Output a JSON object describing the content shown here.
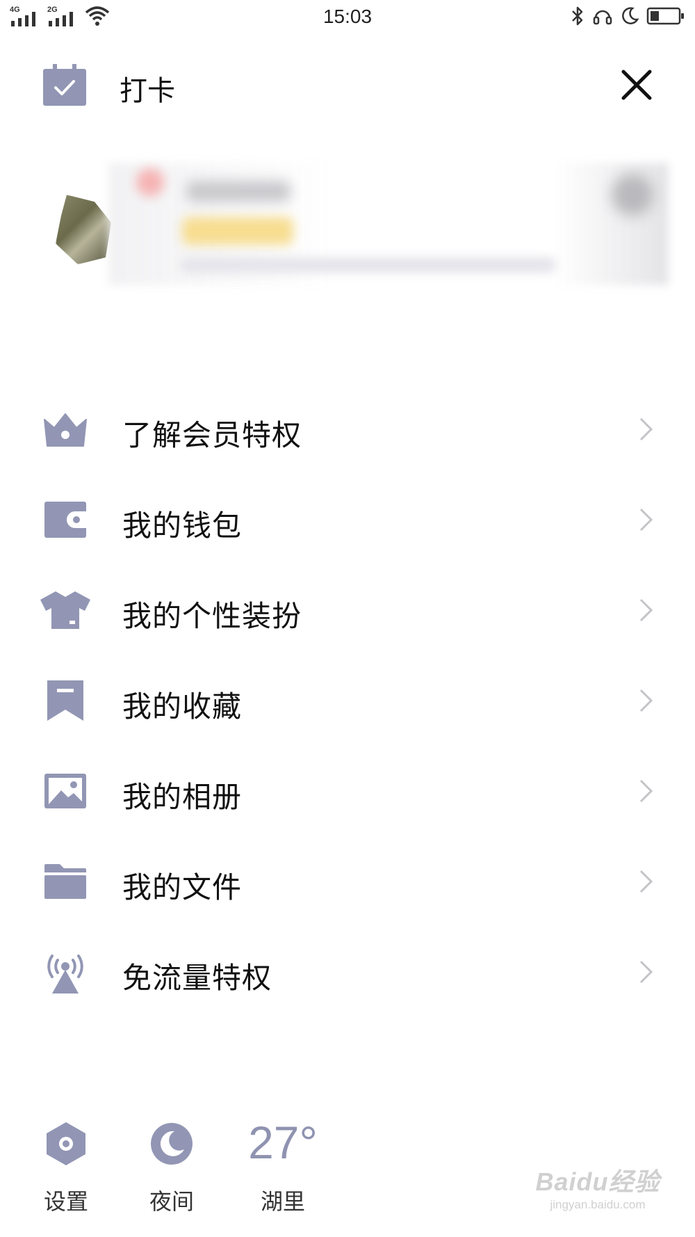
{
  "status_bar": {
    "network1": "4G",
    "network2": "2G",
    "time": "15:03"
  },
  "header": {
    "title": "打卡"
  },
  "menu": {
    "items": [
      {
        "label": "了解会员特权",
        "icon": "crown-icon"
      },
      {
        "label": "我的钱包",
        "icon": "wallet-icon"
      },
      {
        "label": "我的个性装扮",
        "icon": "tshirt-icon"
      },
      {
        "label": "我的收藏",
        "icon": "bookmark-icon"
      },
      {
        "label": "我的相册",
        "icon": "photo-icon"
      },
      {
        "label": "我的文件",
        "icon": "folder-icon"
      },
      {
        "label": "免流量特权",
        "icon": "signal-tower-icon"
      }
    ]
  },
  "bottom": {
    "settings_label": "设置",
    "night_label": "夜间",
    "temperature": "27°",
    "location": "湖里"
  },
  "watermark": {
    "main": "Baidu经验",
    "sub": "jingyan.baidu.com"
  },
  "colors": {
    "icon": "#9296b4",
    "text": "#111111",
    "chevron": "#c4c4c8"
  }
}
